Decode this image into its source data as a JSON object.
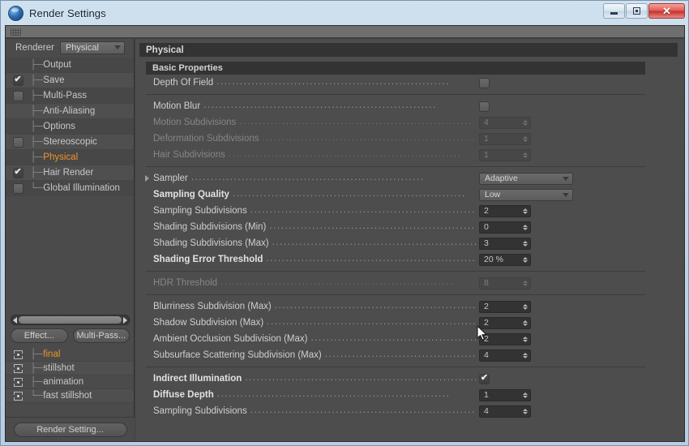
{
  "window": {
    "title": "Render Settings",
    "icon": "c4d-sphere-icon",
    "buttons": {
      "minimize": "minimize-icon",
      "maximize": "restore-icon",
      "close": "close-icon"
    }
  },
  "left": {
    "renderer_label": "Renderer",
    "renderer_value": "Physical",
    "tree": [
      {
        "label": "Output",
        "checkbox": "none",
        "selected": false
      },
      {
        "label": "Save",
        "checkbox": "checked",
        "selected": false
      },
      {
        "label": "Multi-Pass",
        "checkbox": "unchecked",
        "selected": false
      },
      {
        "label": "Anti-Aliasing",
        "checkbox": "none",
        "selected": false
      },
      {
        "label": "Options",
        "checkbox": "none",
        "selected": false
      },
      {
        "label": "Stereoscopic",
        "checkbox": "unchecked",
        "selected": false
      },
      {
        "label": "Physical",
        "checkbox": "none",
        "selected": true
      },
      {
        "label": "Hair Render",
        "checkbox": "checked",
        "selected": false
      },
      {
        "label": "Global Illumination",
        "checkbox": "unchecked",
        "selected": false
      }
    ],
    "buttons": {
      "effect": "Effect...",
      "multipass": "Multi-Pass..."
    },
    "presets": [
      {
        "label": "final",
        "selected": true
      },
      {
        "label": "stillshot",
        "selected": false
      },
      {
        "label": "animation",
        "selected": false
      },
      {
        "label": "fast stillshot",
        "selected": false
      }
    ],
    "render_setting_button": "Render Setting..."
  },
  "panel": {
    "title": "Physical",
    "group_title": "Basic Properties",
    "rows": [
      {
        "label": "Depth Of Field",
        "type": "toggle",
        "value": "unchecked",
        "bold": false,
        "disabled": false
      },
      {
        "sep": true
      },
      {
        "label": "Motion Blur",
        "type": "toggle",
        "value": "unchecked",
        "bold": false,
        "disabled": false
      },
      {
        "label": "Motion Subdivisions",
        "type": "number",
        "value": "4",
        "bold": false,
        "disabled": true
      },
      {
        "label": "Deformation Subdivisions",
        "type": "number",
        "value": "1",
        "bold": false,
        "disabled": true
      },
      {
        "label": "Hair Subdivisions",
        "type": "number",
        "value": "1",
        "bold": false,
        "disabled": true
      },
      {
        "sep": true
      },
      {
        "label": "Sampler",
        "type": "select",
        "value": "Adaptive",
        "bold": false,
        "disabled": false,
        "expander": true
      },
      {
        "label": "Sampling Quality",
        "type": "select",
        "value": "Low",
        "bold": true,
        "disabled": false
      },
      {
        "label": "Sampling Subdivisions",
        "type": "number",
        "value": "2",
        "bold": false,
        "disabled": false
      },
      {
        "label": "Shading Subdivisions (Min)",
        "type": "number",
        "value": "0",
        "bold": false,
        "disabled": false
      },
      {
        "label": "Shading Subdivisions (Max)",
        "type": "number",
        "value": "3",
        "bold": false,
        "disabled": false
      },
      {
        "label": "Shading Error Threshold",
        "type": "number",
        "value": "20 %",
        "bold": true,
        "disabled": false
      },
      {
        "sep": true
      },
      {
        "label": "HDR Threshold",
        "type": "number",
        "value": "8",
        "bold": false,
        "disabled": true
      },
      {
        "sep": true
      },
      {
        "label": "Blurriness Subdivision (Max)",
        "type": "number",
        "value": "2",
        "bold": false,
        "disabled": false
      },
      {
        "label": "Shadow Subdivision (Max)",
        "type": "number",
        "value": "2",
        "bold": false,
        "disabled": false
      },
      {
        "label": "Ambient Occlusion Subdivision (Max)",
        "type": "number",
        "value": "2",
        "bold": false,
        "disabled": false
      },
      {
        "label": "Subsurface Scattering Subdivision (Max)",
        "type": "number",
        "value": "4",
        "bold": false,
        "disabled": false
      },
      {
        "sep": true
      },
      {
        "label": "Indirect Illumination",
        "type": "toggle",
        "value": "checked",
        "bold": true,
        "disabled": false
      },
      {
        "label": "Diffuse Depth",
        "type": "number",
        "value": "1",
        "bold": true,
        "disabled": false
      },
      {
        "label": "Sampling Subdivisions",
        "type": "number",
        "value": "4",
        "bold": false,
        "disabled": false
      }
    ]
  },
  "colors": {
    "accent_orange": "#f0942a",
    "panel_bg": "#4d4d4d",
    "sidebar_bg": "#4b4b4b",
    "header_bar": "#333333",
    "close_button_red": "#c6332c"
  }
}
